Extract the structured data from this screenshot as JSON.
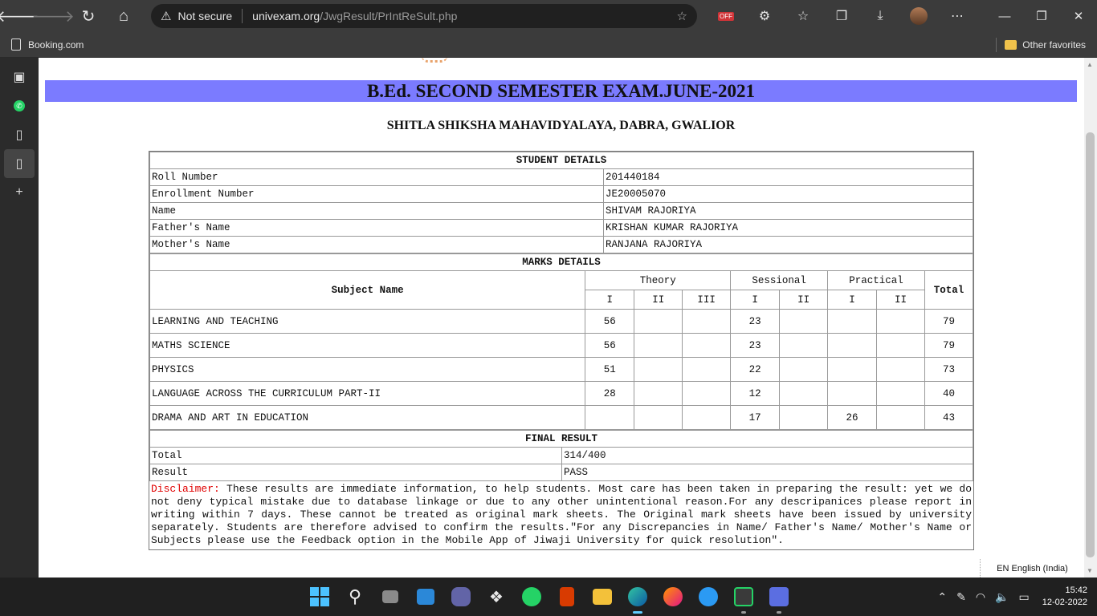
{
  "browser": {
    "security_label": "Not secure",
    "url_domain": "univexam.org",
    "url_path": "/JwgResult/PrIntReSult.php",
    "off_badge": "OFF",
    "favorites": [
      {
        "label": "Booking.com"
      }
    ],
    "other_favorites_label": "Other favorites"
  },
  "page": {
    "exam_title": "B.Ed. SECOND SEMESTER EXAM.JUNE-2021",
    "college": "SHITLA SHIKSHA MAHAVIDYALAYA, DABRA, GWALIOR",
    "student_section": "STUDENT DETAILS",
    "student": [
      {
        "label": "Roll Number",
        "value": "201440184"
      },
      {
        "label": "Enrollment Number",
        "value": "JE20005070"
      },
      {
        "label": "Name",
        "value": "SHIVAM RAJORIYA"
      },
      {
        "label": "Father's Name",
        "value": "KRISHAN KUMAR RAJORIYA"
      },
      {
        "label": "Mother's Name",
        "value": "RANJANA RAJORIYA"
      }
    ],
    "marks_section": "MARKS DETAILS",
    "marks_headers": {
      "subject": "Subject Name",
      "theory": "Theory",
      "sessional": "Sessional",
      "practical": "Practical",
      "total": "Total",
      "theory_cols": [
        "I",
        "II",
        "III"
      ],
      "sessional_cols": [
        "I",
        "II"
      ],
      "practical_cols": [
        "I",
        "II"
      ]
    },
    "marks": [
      {
        "subject": "LEARNING AND TEACHING",
        "th1": "56",
        "th2": "",
        "th3": "",
        "se1": "23",
        "se2": "",
        "pr1": "",
        "pr2": "",
        "total": "79"
      },
      {
        "subject": "MATHS SCIENCE",
        "th1": "56",
        "th2": "",
        "th3": "",
        "se1": "23",
        "se2": "",
        "pr1": "",
        "pr2": "",
        "total": "79"
      },
      {
        "subject": "PHYSICS",
        "th1": "51",
        "th2": "",
        "th3": "",
        "se1": "22",
        "se2": "",
        "pr1": "",
        "pr2": "",
        "total": "73"
      },
      {
        "subject": "LANGUAGE ACROSS THE CURRICULUM PART-II",
        "th1": "28",
        "th2": "",
        "th3": "",
        "se1": "12",
        "se2": "",
        "pr1": "",
        "pr2": "",
        "total": "40"
      },
      {
        "subject": "DRAMA AND ART IN EDUCATION",
        "th1": "",
        "th2": "",
        "th3": "",
        "se1": "17",
        "se2": "",
        "pr1": "26",
        "pr2": "",
        "total": "43"
      }
    ],
    "final_section": "FINAL RESULT",
    "final": [
      {
        "label": "Total",
        "value": "314/400"
      },
      {
        "label": "Result",
        "value": "PASS"
      }
    ],
    "disclaimer_label": "Disclaimer:",
    "disclaimer_text": " These results are immediate information, to help students. Most care has been taken in preparing the result: yet we do not deny typical mistake due to database linkage or due to any other unintentional reason.For any descripanices please report in writing within 7 days. These cannot be treated as original mark sheets. The Original mark sheets have been issued by university separately. Students are therefore advised to confirm the results.\"For any Discrepancies in Name/ Father's Name/ Mother's Name or Subjects please use the Feedback option in the Mobile App of Jiwaji University for quick resolution\"."
  },
  "language_tooltip": "EN English (India)",
  "taskbar": {
    "time": "15:42",
    "date": "12-02-2022"
  },
  "colors": {
    "banner": "#7b7bff",
    "disclaimer_red": "#e00000",
    "chrome_bg": "#3b3b3b",
    "taskbar_bg": "#202020"
  }
}
